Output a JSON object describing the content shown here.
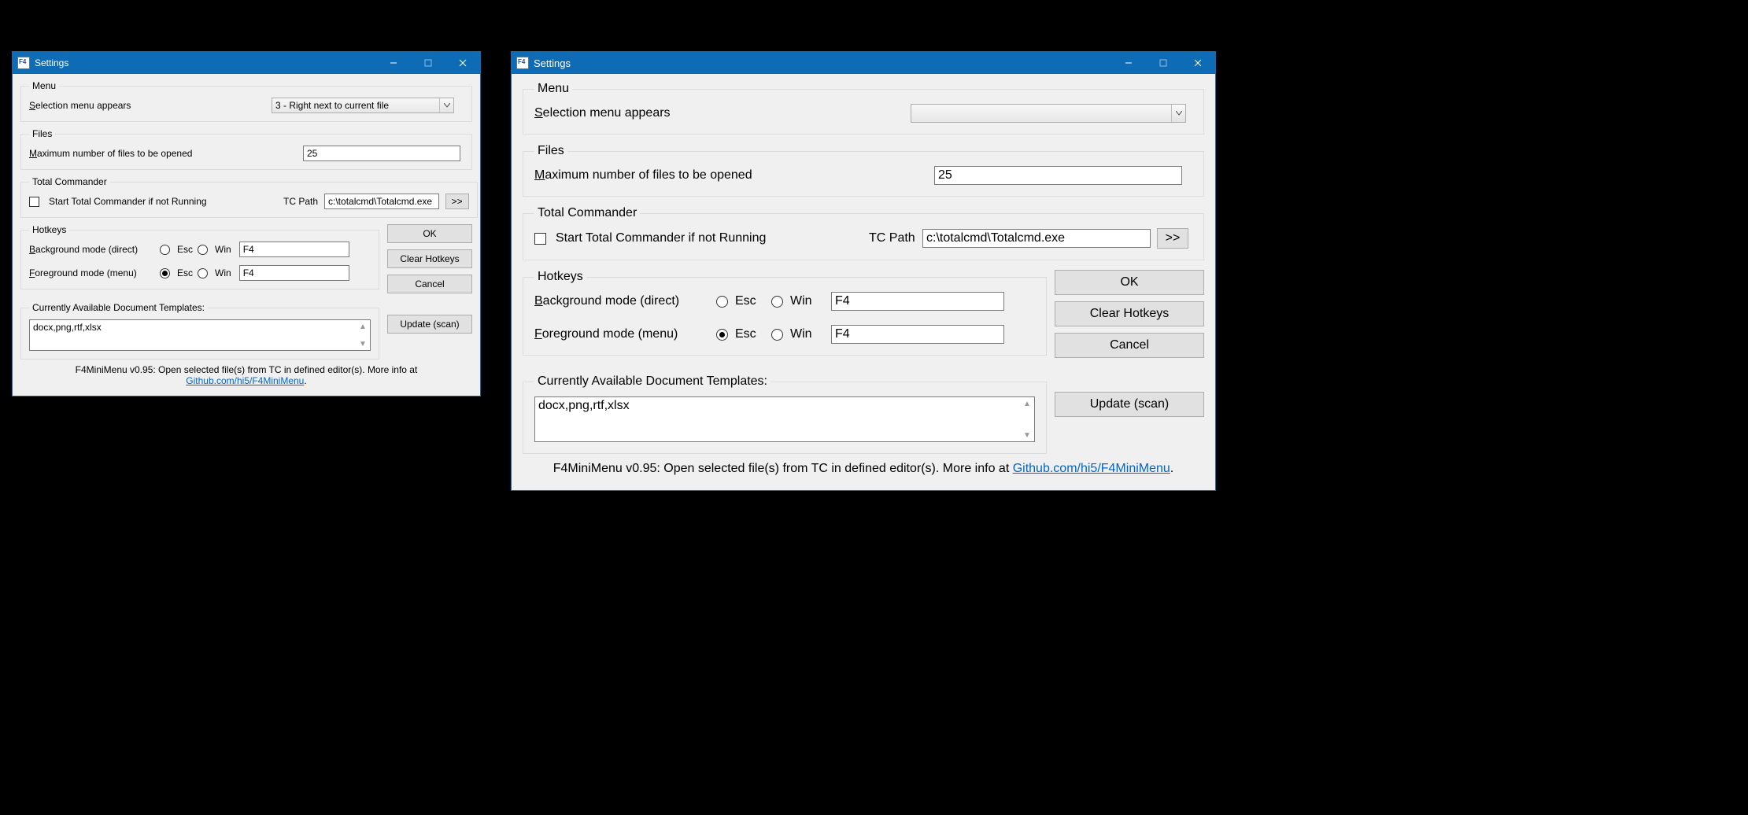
{
  "title": "Settings",
  "menu": {
    "legend": "Menu",
    "selection_label": "Selection menu appears",
    "selection_value_small": "3 - Right next to current file",
    "selection_value_large": ""
  },
  "files": {
    "legend": "Files",
    "max_label": "Maximum number of files to be opened",
    "max_value": "25"
  },
  "tc": {
    "legend": "Total Commander",
    "start_label": "Start Total Commander if not Running",
    "path_label": "TC Path",
    "path_value": "c:\\totalcmd\\Totalcmd.exe",
    "browse_label": ">>"
  },
  "hotkeys": {
    "legend": "Hotkeys",
    "bg_label": "Background mode (direct)",
    "fg_label": "Foreground mode (menu)",
    "esc_label": "Esc",
    "win_label": "Win",
    "bg_value": "F4",
    "fg_value": "F4"
  },
  "buttons": {
    "ok": "OK",
    "clear": "Clear Hotkeys",
    "cancel": "Cancel",
    "update": "Update (scan)"
  },
  "templates": {
    "legend": "Currently Available Document Templates:",
    "value": "docx,png,rtf,xlsx"
  },
  "footer": {
    "text_prefix": "F4MiniMenu v0.95: Open selected file(s) from TC in defined editor(s). More info at ",
    "link_text": "Github.com/hi5/F4MiniMenu",
    "text_suffix": "."
  }
}
